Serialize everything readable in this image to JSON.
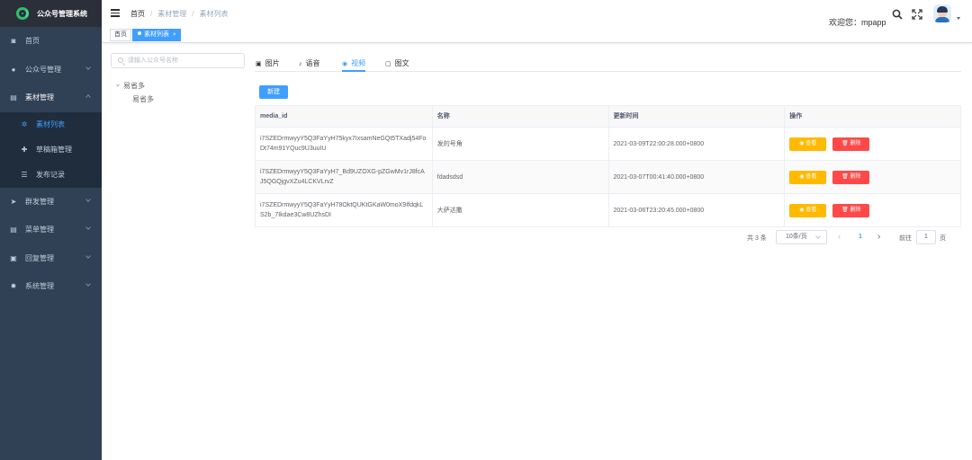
{
  "app": {
    "title": "公众号管理系统"
  },
  "sidebar": {
    "items": [
      {
        "label": "首页",
        "icon": "dashboard-icon"
      },
      {
        "label": "公众号管理",
        "icon": "wechat-icon"
      },
      {
        "label": "素材管理",
        "icon": "document-icon",
        "expanded": true,
        "children": [
          {
            "label": "素材列表",
            "icon": "gear-icon",
            "active": true
          },
          {
            "label": "草稿箱管理",
            "icon": "plus-icon"
          },
          {
            "label": "发布记录",
            "icon": "list-icon"
          }
        ]
      },
      {
        "label": "群发管理",
        "icon": "send-icon"
      },
      {
        "label": "菜单管理",
        "icon": "document-icon"
      },
      {
        "label": "回复管理",
        "icon": "chat-icon"
      },
      {
        "label": "系统管理",
        "icon": "gear-icon"
      }
    ]
  },
  "navbar": {
    "breadcrumb": [
      "首页",
      "素材管理",
      "素材列表"
    ],
    "welcome": "欢迎您：mpapp"
  },
  "tags": [
    {
      "label": "首页",
      "active": false
    },
    {
      "label": "素材列表",
      "active": true,
      "close": "×"
    }
  ],
  "tree": {
    "search_placeholder": "请输入公众号名称",
    "root": "易省多",
    "child": "易省多"
  },
  "tabs": [
    {
      "label": "图片",
      "icon": "image-icon",
      "glyph": "▣"
    },
    {
      "label": "语音",
      "icon": "microphone-icon",
      "glyph": "♪"
    },
    {
      "label": "视频",
      "icon": "video-icon",
      "glyph": "◉",
      "active": true
    },
    {
      "label": "图文",
      "icon": "news-icon",
      "glyph": "▢"
    }
  ],
  "toolbar": {
    "new_label": "新建"
  },
  "table": {
    "headers": [
      "media_id",
      "名称",
      "更新时间",
      "操作"
    ],
    "rows": [
      {
        "media_id": "i7SZEDrmwyyY5Q3FaYyH75kyx7IxsamNeGQt5TXadj54FoDt74m91YQuc9U3uuIU",
        "name": "发的号角",
        "updated": "2021-03-09T22:00:28.000+0800"
      },
      {
        "media_id": "i7SZEDrmwyyY5Q3FaYyH7_Bd9UZOXG-pZGwMv1rJ8fcAJ5QGQjgvXZu4LCKVLrvZ",
        "name": "fdadsdsd",
        "updated": "2021-03-07T00:41:40.000+0800"
      },
      {
        "media_id": "i7SZEDrmwyyY5Q3FaYyH78OktQUKtGKaW0moX9IfdqkLS2b_7Ikdae3Cw8UZhsDI",
        "name": "大萨达撒",
        "updated": "2021-03-06T23:20:45.000+0800"
      }
    ],
    "view_label": "查看",
    "delete_label": "删除"
  },
  "pagination": {
    "total": "共 3 条",
    "page_size": "10条/页",
    "prev": "‹",
    "current": "1",
    "next": "›",
    "goto_label": "前往",
    "goto_value": "1",
    "goto_suffix": "页"
  },
  "colors": {
    "sidebar": "#304156",
    "primary": "#409eff",
    "warning": "#ffba00",
    "danger": "#ff4949"
  }
}
